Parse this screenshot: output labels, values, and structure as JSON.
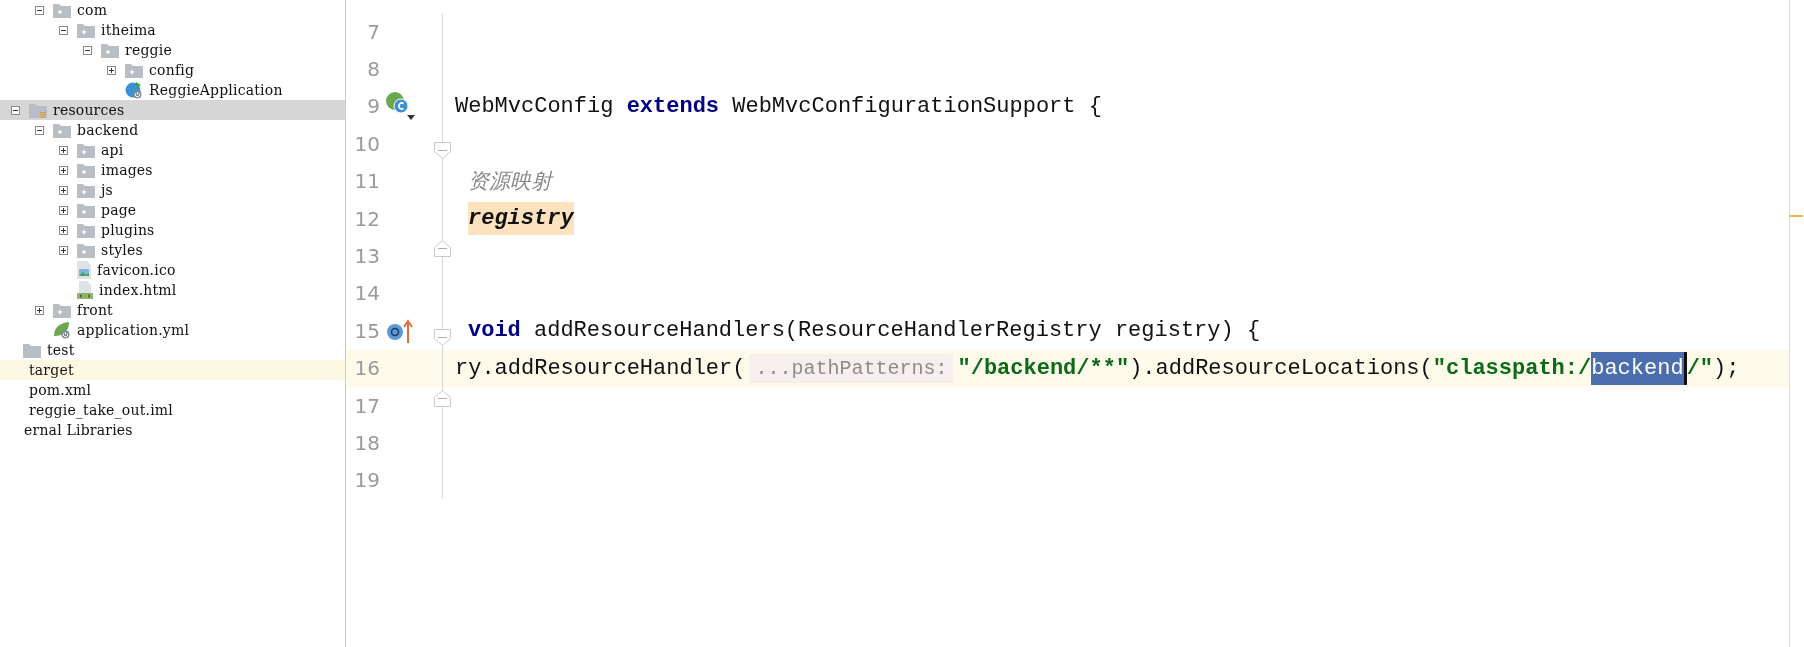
{
  "project_tree": [
    {
      "label": "com",
      "kind": "package",
      "expanded": true,
      "selected": false,
      "children": [
        {
          "label": "itheima",
          "kind": "package",
          "expanded": true,
          "selected": false,
          "children": [
            {
              "label": "reggie",
              "kind": "package",
              "expanded": true,
              "selected": false,
              "children": [
                {
                  "label": "config",
                  "kind": "package",
                  "expanded": false,
                  "selected": false
                },
                {
                  "label": "ReggieApplication",
                  "kind": "spring-class",
                  "selected": false
                }
              ]
            }
          ]
        }
      ]
    },
    {
      "label": "resources",
      "kind": "resource-root",
      "expanded": true,
      "selected": true,
      "children": [
        {
          "label": "backend",
          "kind": "package",
          "expanded": true,
          "selected": false,
          "children": [
            {
              "label": "api",
              "kind": "package",
              "expanded": false,
              "selected": false
            },
            {
              "label": "images",
              "kind": "package",
              "expanded": false,
              "selected": false
            },
            {
              "label": "js",
              "kind": "package",
              "expanded": false,
              "selected": false
            },
            {
              "label": "page",
              "kind": "package",
              "expanded": false,
              "selected": false
            },
            {
              "label": "plugins",
              "kind": "package",
              "expanded": false,
              "selected": false
            },
            {
              "label": "styles",
              "kind": "package",
              "expanded": false,
              "selected": false
            },
            {
              "label": "favicon.ico",
              "kind": "image-file",
              "selected": false
            },
            {
              "label": "index.html",
              "kind": "html-file",
              "selected": false
            }
          ]
        },
        {
          "label": "front",
          "kind": "package",
          "expanded": false,
          "selected": false
        },
        {
          "label": "application.yml",
          "kind": "spring-config",
          "selected": false
        }
      ]
    },
    {
      "label": "test",
      "kind": "folder",
      "selected": false
    },
    {
      "label": "target",
      "kind": "excluded",
      "selected": false
    },
    {
      "label": "pom.xml",
      "kind": "cut-file",
      "selected": false
    },
    {
      "label": "reggie_take_out.iml",
      "kind": "cut-file",
      "selected": false
    },
    {
      "label": "ernal Libraries",
      "kind": "cut-far",
      "selected": false
    }
  ],
  "editor": {
    "lines": [
      {
        "number": "7",
        "current": false
      },
      {
        "number": "8",
        "current": false
      },
      {
        "number": "9",
        "current": false,
        "gutter_icon": {
          "kind": "bean-class"
        },
        "tokens": [
          {
            "kind": "plain",
            "text": "WebMvcConfig "
          },
          {
            "kind": "keyword",
            "text": "extends"
          },
          {
            "kind": "plain",
            "text": " WebMvcConfigurationSupport {"
          }
        ]
      },
      {
        "number": "10",
        "current": false,
        "fold_marker": {
          "kind": "start"
        }
      },
      {
        "number": "11",
        "current": false,
        "tokens": [
          {
            "kind": "comment",
            "text": "资源映射"
          }
        ]
      },
      {
        "number": "12",
        "current": false,
        "tokens": [
          {
            "kind": "param",
            "text": "registry"
          }
        ]
      },
      {
        "number": "13",
        "current": false,
        "fold_marker": {
          "kind": "end"
        }
      },
      {
        "number": "14",
        "current": false
      },
      {
        "number": "15",
        "current": false,
        "gutter_icon": {
          "kind": "override"
        },
        "fold_marker": {
          "kind": "start"
        },
        "tokens": [
          {
            "kind": "keyword",
            "text": "void"
          },
          {
            "kind": "plain",
            "text": " addResourceHandlers(ResourceHandlerRegistry registry) {"
          }
        ]
      },
      {
        "number": "16",
        "current": true,
        "tokens": [
          {
            "kind": "plain",
            "text": "ry.addResourceHandler("
          },
          {
            "kind": "hint",
            "text": "...pathPatterns:"
          },
          {
            "kind": "string",
            "text": "\"/backend/**\""
          },
          {
            "kind": "plain",
            "text": ").addResourceLocations("
          },
          {
            "kind": "string",
            "text": "\"classpath:/"
          },
          {
            "kind": "selection",
            "text": "backend"
          },
          {
            "kind": "string",
            "text": "/\""
          },
          {
            "kind": "plain",
            "text": ");"
          }
        ]
      },
      {
        "number": "17",
        "current": false,
        "fold_marker": {
          "kind": "end"
        }
      },
      {
        "number": "18",
        "current": false
      },
      {
        "number": "19",
        "current": false
      }
    ]
  }
}
